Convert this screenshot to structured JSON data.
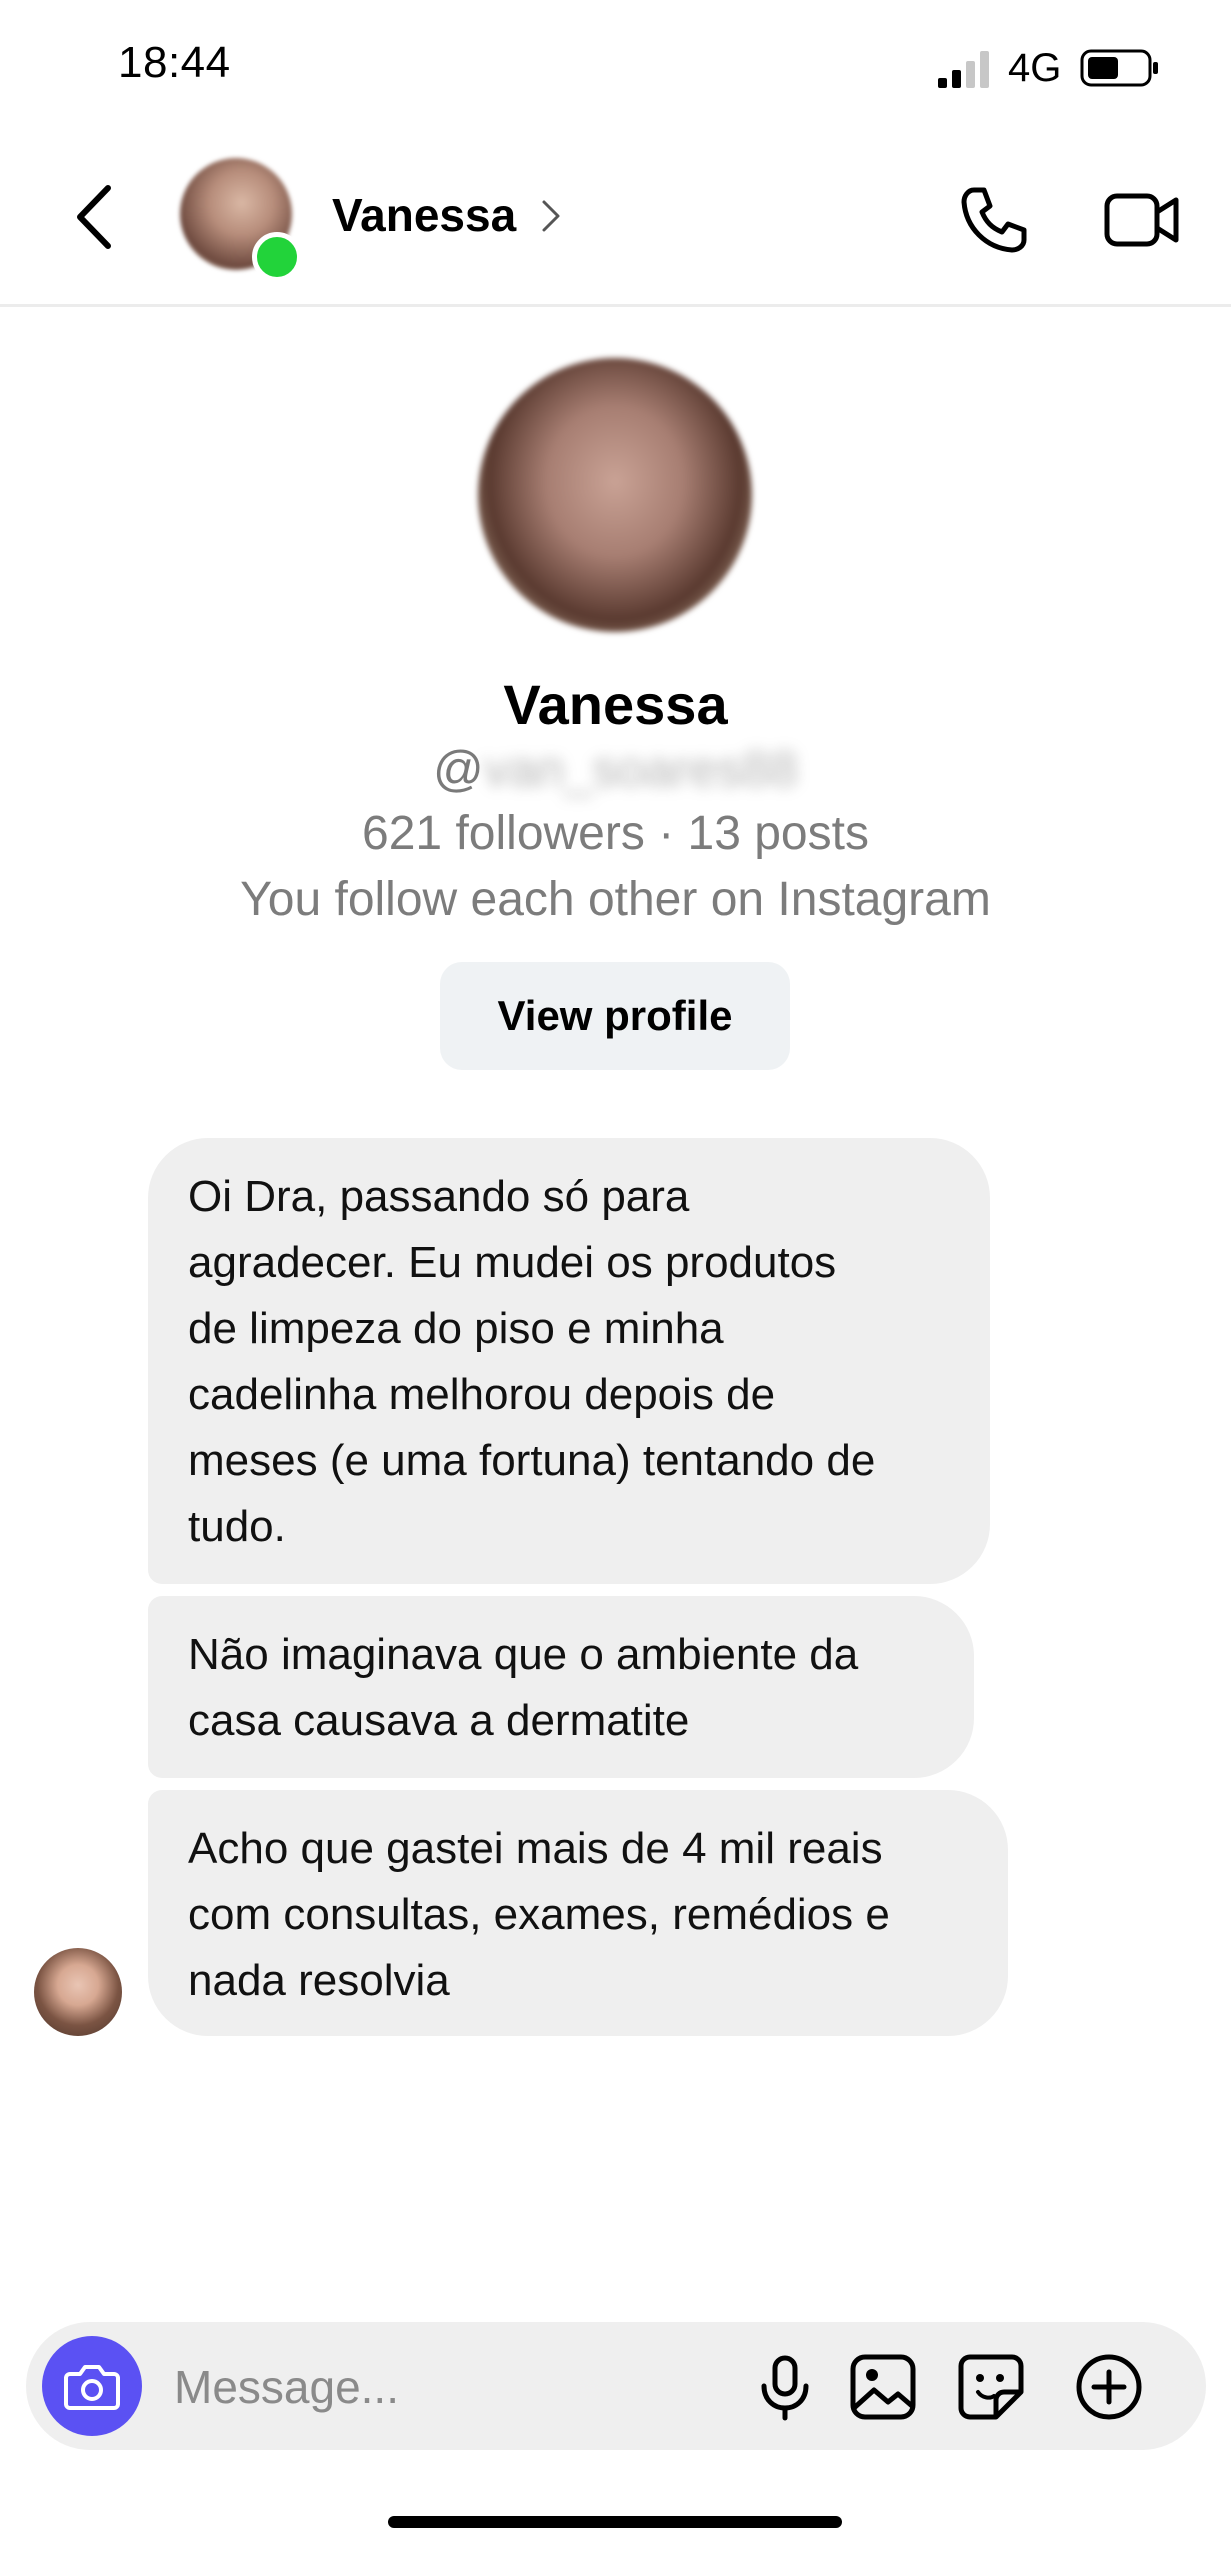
{
  "status_bar": {
    "time": "18:44",
    "network": "4G",
    "signal_bars": 2,
    "battery_level": 0.5
  },
  "header": {
    "name": "Vanessa",
    "online": true,
    "icons": [
      "back-icon",
      "chevron-right-icon",
      "phone-icon",
      "video-camera-icon"
    ]
  },
  "profile": {
    "name": "Vanessa",
    "handle_prefix": "@",
    "handle_rest": "van_soares88",
    "stats": "621 followers · 13 posts",
    "note": "You follow each other on Instagram",
    "view_profile_label": "View profile"
  },
  "messages": [
    {
      "text": "Oi Dra, passando só para\nagradecer. Eu mudei os produtos\nde limpeza do piso e minha\ncadelinha melhorou depois de\nmeses (e uma fortuna) tentando de\ntudo."
    },
    {
      "text": "Não imaginava que o ambiente da\ncasa causava a dermatite"
    },
    {
      "text": "Acho que gastei mais de 4 mil reais\ncom consultas, exames, remédios e\nnada resolvia"
    }
  ],
  "composer": {
    "placeholder": "Message...",
    "icons": [
      "camera-icon",
      "microphone-icon",
      "gallery-icon",
      "sticker-icon",
      "plus-icon"
    ],
    "camera_color": "#5b51f3"
  },
  "colors": {
    "online": "#22d33a",
    "bubble": "#efefef",
    "secondary_text": "#7c7c7c"
  }
}
